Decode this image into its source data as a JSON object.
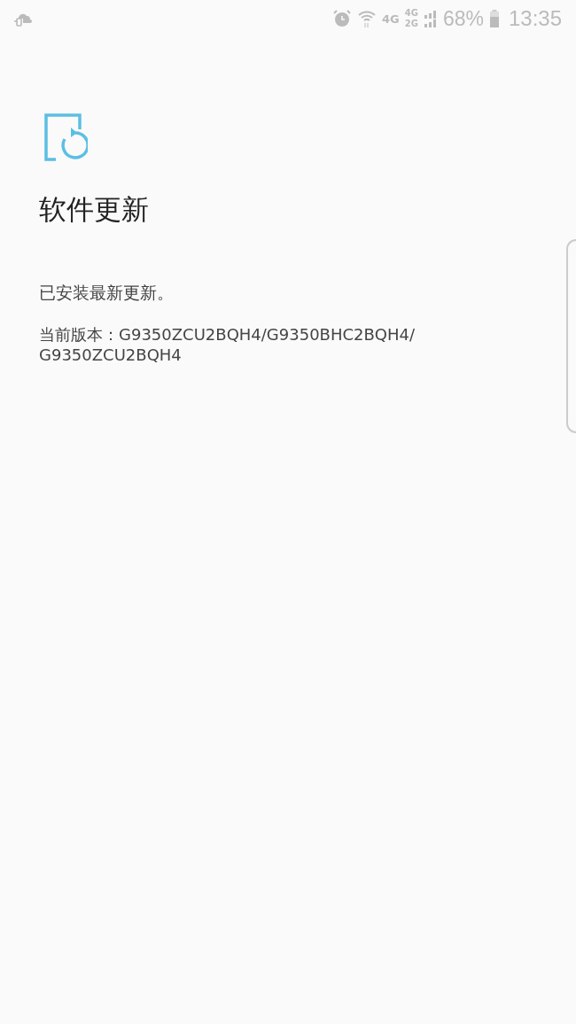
{
  "status_bar": {
    "network_labels": [
      "4G",
      "4G",
      "2G"
    ],
    "battery": "68%",
    "time": "13:35"
  },
  "page": {
    "title": "软件更新",
    "message": "已安装最新更新。",
    "version": "当前版本：G9350ZCU2BQH4/G9350BHC2BQH4/G9350ZCU2BQH4"
  }
}
